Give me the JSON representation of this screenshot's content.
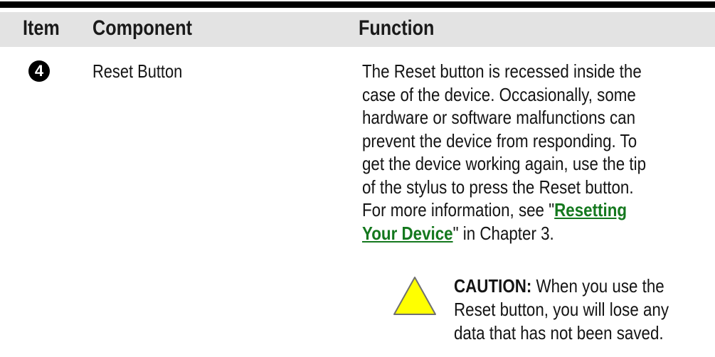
{
  "table": {
    "columns": [
      "Item",
      "Component",
      "Function"
    ],
    "rows": [
      {
        "item_number": "4",
        "component": "Reset Button",
        "function_lines": [
          "The Reset button is recessed inside the",
          "case of the device. Occasionally, some",
          "hardware or software malfunctions can",
          "prevent the device from responding. To",
          "get the device working again, use the tip",
          "of the stylus to press the Reset button."
        ],
        "more_info": {
          "prefix": "For more information, see \"",
          "link_line1": "Resetting",
          "link_line2": "Your Device",
          "suffix": "\" in Chapter 3."
        },
        "caution": {
          "icon": "warning-triangle-icon",
          "icon_color": "#FFFF00",
          "label": "CAUTION:",
          "line1_rest": " When you use the",
          "line2": "Reset button, you will lose any",
          "line3": "data that has not been saved."
        }
      }
    ]
  },
  "colors": {
    "header_background": "#E3E3E3",
    "rule": "#000000",
    "link": "#14781E"
  }
}
